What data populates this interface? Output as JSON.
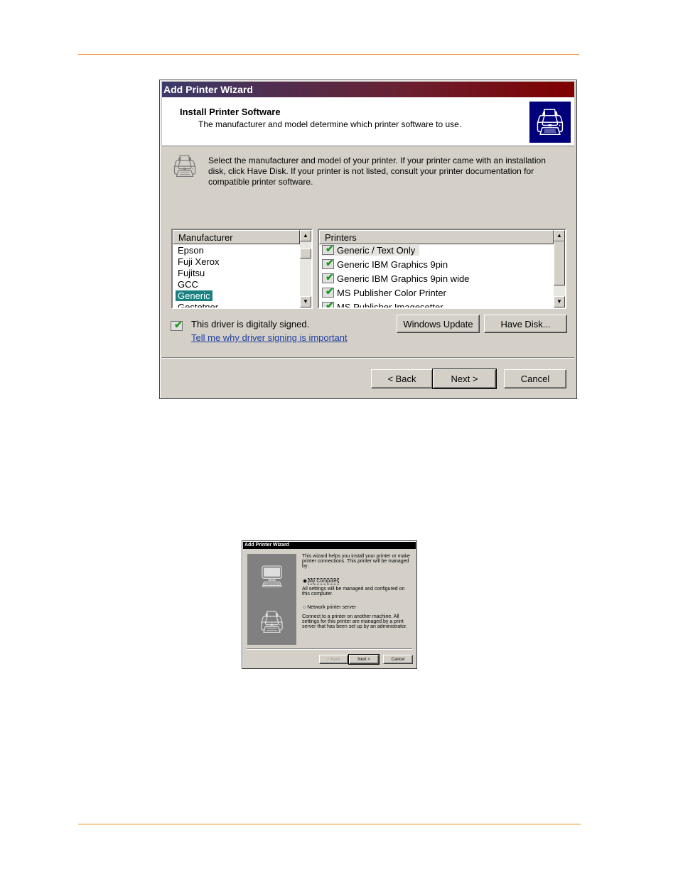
{
  "main_dialog": {
    "title": "Add Printer Wizard",
    "heading": "Install Printer Software",
    "subheading": "The manufacturer and model determine which printer software to use.",
    "instructions": "Select the manufacturer and model of your printer. If your printer came with an installation disk, click Have Disk. If your printer is not listed, consult your printer documentation for compatible printer software.",
    "manufacturer_header": "Manufacturer",
    "manufacturers": [
      "Epson",
      "Fuji Xerox",
      "Fujitsu",
      "GCC",
      "Generic",
      "Gestetner"
    ],
    "selected_manufacturer": "Generic",
    "printers_header": "Printers",
    "printers": [
      "Generic / Text Only",
      "Generic IBM Graphics 9pin",
      "Generic IBM Graphics 9pin wide",
      "MS Publisher Color Printer",
      "MS Publisher Imagesetter"
    ],
    "signed_text": "This driver is digitally signed.",
    "signing_link": "Tell me why driver signing is important",
    "windows_update": "Windows Update",
    "have_disk": "Have Disk...",
    "back": "< Back",
    "next": "Next >",
    "cancel": "Cancel",
    "accent_color": "#1a8080"
  },
  "small_dialog": {
    "title": "Add Printer Wizard",
    "intro": "This wizard helps you install your printer or make printer connections.  This printer will be managed by:",
    "option_my_computer": "My Computer",
    "my_computer_desc": "All settings will be managed and configured on this computer.",
    "option_network": "Network printer server",
    "network_desc": "Connect to a printer on another machine.  All settings for this printer are managed by a print server that has been set up by an administrator.",
    "back": "< Back",
    "next": "Next >",
    "cancel": "Cancel"
  }
}
